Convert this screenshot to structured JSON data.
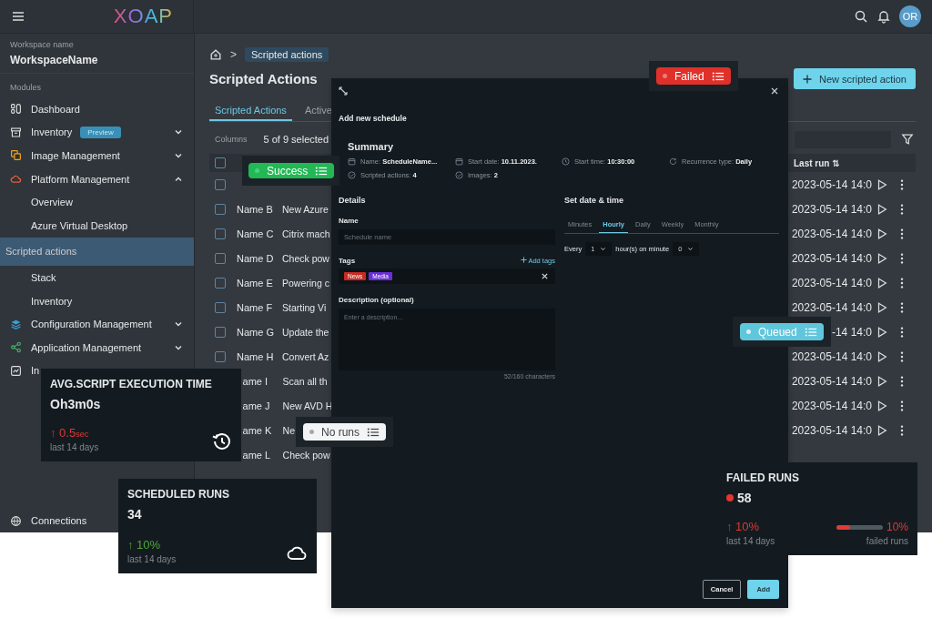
{
  "topbar": {
    "logo": "XOAP",
    "avatar": "OR"
  },
  "sidebar": {
    "workspace_label": "Workspace name",
    "workspace_name": "WorkspaceName",
    "section": "Modules",
    "items": [
      {
        "label": "Dashboard",
        "selected": false
      },
      {
        "label": "Inventory",
        "badge": "Preview",
        "expanded": false,
        "selected": false
      },
      {
        "label": "Image Management",
        "expanded": false,
        "selected": false
      },
      {
        "label": "Platform Management",
        "expanded": true,
        "selected": false,
        "children": [
          {
            "label": "Overview",
            "selected": false
          },
          {
            "label": "Azure Virtual Desktop",
            "selected": false
          },
          {
            "label": "Scripted actions",
            "selected": true
          },
          {
            "label": "Stack",
            "selected": false
          },
          {
            "label": "Inventory",
            "selected": false
          }
        ]
      },
      {
        "label": "Configuration Management",
        "expanded": false,
        "selected": false
      },
      {
        "label": "Application Management",
        "expanded": false,
        "selected": false
      },
      {
        "label": "In",
        "selected": false
      }
    ],
    "footer_item": "Connections"
  },
  "breadcrumb": {
    "separator": ">",
    "current": "Scripted actions"
  },
  "page_title": "Scripted Actions",
  "new_button": "New scripted action",
  "tabs": [
    {
      "label": "Scripted Actions",
      "selected": true
    },
    {
      "label": "Active",
      "selected": false
    }
  ],
  "columns_control": {
    "label": "Columns",
    "value": "5 of 9 selected"
  },
  "table": {
    "header_checked": false,
    "columns": [
      {
        "label": "Last run",
        "sort": "⇅"
      }
    ],
    "rows": [
      {
        "checked": false,
        "last_run": "2023-05-14 14:0"
      },
      {
        "checked": false,
        "name": "Name B",
        "description": "New Azure",
        "last_run": "2023-05-14 14:0"
      },
      {
        "checked": false,
        "name": "Name C",
        "description": "Citrix mach",
        "last_run": "2023-05-14 14:0"
      },
      {
        "checked": false,
        "name": "Name D",
        "description": "Check pow",
        "last_run": "2023-05-14 14:0"
      },
      {
        "checked": false,
        "name": "Name E",
        "description": "Powering c",
        "last_run": "2023-05-14 14:0"
      },
      {
        "checked": false,
        "name": "Name F",
        "description": "Starting Vi",
        "last_run": "2023-05-14 14:0"
      },
      {
        "checked": false,
        "name": "Name G",
        "description": "Update the",
        "last_run": "-14 14:0"
      },
      {
        "checked": false,
        "name": "Name H",
        "description": "Convert Az",
        "last_run": "2023-05-14 14:0"
      },
      {
        "name": "ame I",
        "description": "Scan all th",
        "last_run": "2023-05-14 14:0"
      },
      {
        "name": "ame J",
        "description": "New AVD H",
        "last_run": "2023-05-14 14:0"
      },
      {
        "name": "ame K",
        "description": "Ne",
        "last_run": "2023-05-14 14:0"
      },
      {
        "name": "ame L",
        "description": "Check pow"
      }
    ]
  },
  "modal": {
    "title": "Add new schedule",
    "summary_title": "Summary",
    "summary": [
      "Name: **ScheduleName...**",
      "Start date: **10.11.2023.**",
      "Start time: **10:30:00**",
      "Recurrence type: **Daily**",
      "Scripted actions: **4**",
      "Images: **2**"
    ],
    "details_title": "Details",
    "name_label": "Name",
    "name_placeholder": "Schedule name",
    "tags_label": "Tags",
    "add_tags": "Add tags",
    "tags": [
      {
        "label": "News",
        "color": "#c62b22"
      },
      {
        "label": "Media",
        "color": "#6a2fd6"
      }
    ],
    "description_label": "Description (optional)",
    "description_placeholder": "Enter a description...",
    "counter": "52/160 characters",
    "schedule_title": "Set date & time",
    "schedule_tabs": [
      {
        "label": "Minutes",
        "selected": false
      },
      {
        "label": "Hourly",
        "selected": true
      },
      {
        "label": "Daily",
        "selected": false
      },
      {
        "label": "Weekly",
        "selected": false
      },
      {
        "label": "Monthly",
        "selected": false
      }
    ],
    "every_label": "Every",
    "every_value": "1",
    "minute_label": "hour(s) on minute",
    "minute_value": "0",
    "cancel": "Cancel",
    "add": "Add"
  },
  "status_badges": [
    {
      "kind": "success",
      "label": "Success"
    },
    {
      "kind": "failed",
      "label": "Failed"
    },
    {
      "kind": "queued",
      "label": "Queued"
    },
    {
      "kind": "none",
      "label": "No runs"
    }
  ],
  "stat_cards": [
    {
      "title": "AVG.SCRIPT EXECUTION TIME",
      "value": "Oh3m0s",
      "arrow": "↑",
      "positive": false,
      "change": "0.5",
      "unit": "sec",
      "period": "last 14 days"
    },
    {
      "title": "SCHEDULED RUNS",
      "value": "34",
      "arrow": "↑",
      "positive": true,
      "change": "10%",
      "period": "last 14 days"
    },
    {
      "title": "FAILED RUNS",
      "value": "58",
      "arrow": "↑",
      "positive": false,
      "change": "10%",
      "period": "last 14 days",
      "dot": true,
      "meter": {
        "level": 0.3,
        "reading": "10%",
        "label": "failed runs"
      }
    }
  ]
}
